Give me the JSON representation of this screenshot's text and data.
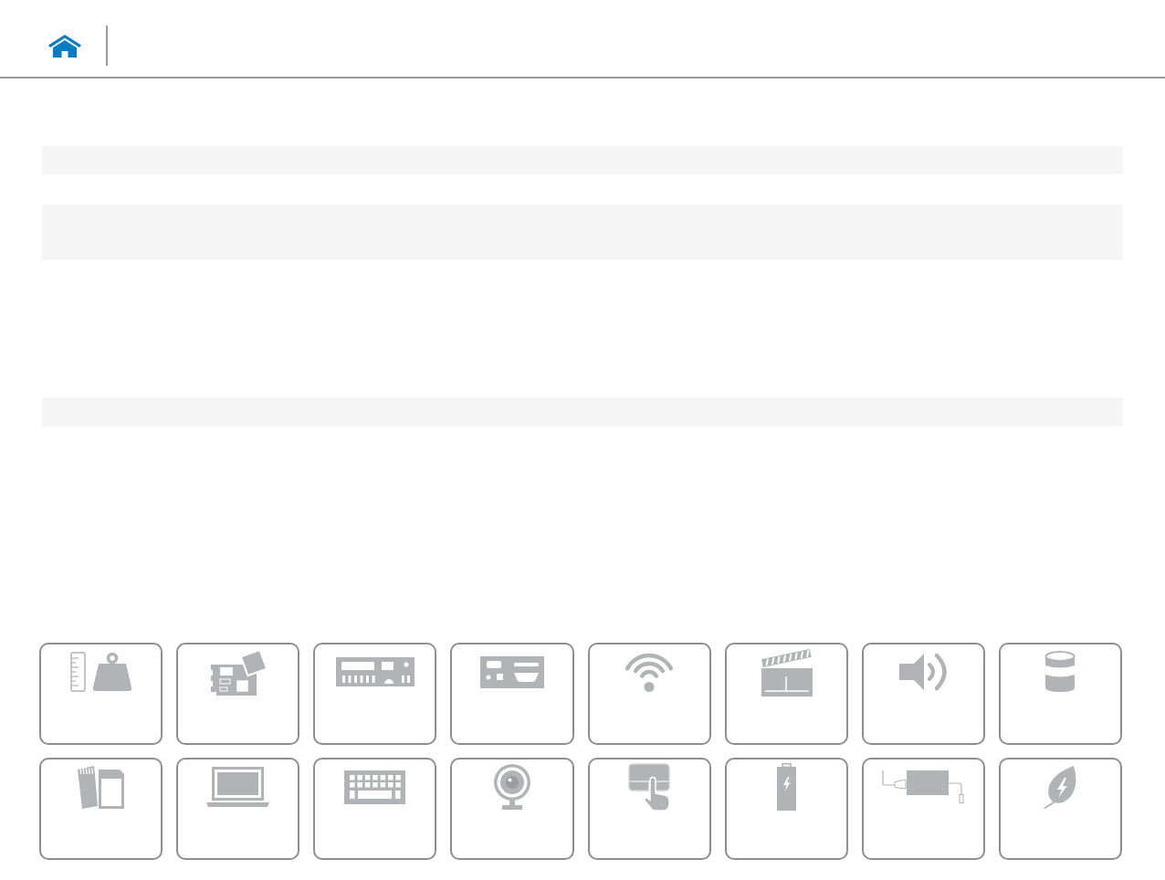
{
  "tiles": [
    {
      "kind": "dimensions"
    },
    {
      "kind": "board"
    },
    {
      "kind": "ports"
    },
    {
      "kind": "panel"
    },
    {
      "kind": "wireless"
    },
    {
      "kind": "media"
    },
    {
      "kind": "audio"
    },
    {
      "kind": "storage"
    },
    {
      "kind": "cards"
    },
    {
      "kind": "display"
    },
    {
      "kind": "keyboard"
    },
    {
      "kind": "camera"
    },
    {
      "kind": "touchpad"
    },
    {
      "kind": "battery"
    },
    {
      "kind": "adapter"
    },
    {
      "kind": "power"
    }
  ]
}
